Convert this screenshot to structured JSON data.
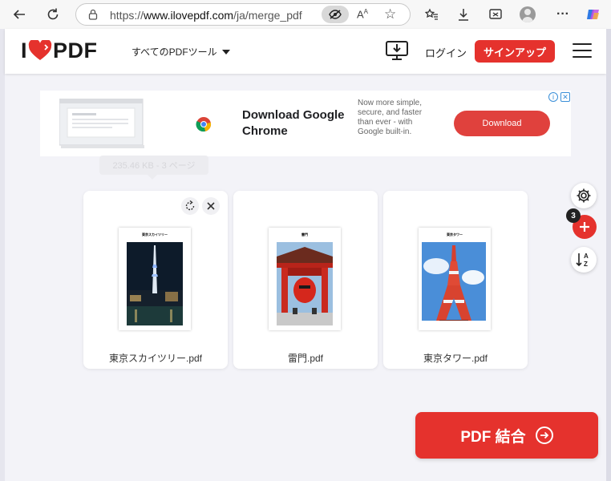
{
  "browser": {
    "url_prefix": "https://",
    "url_host": "www.ilovepdf.com",
    "url_path": "/ja/merge_pdf",
    "reader_label": "A"
  },
  "header": {
    "logo_left": "I",
    "logo_right": "PDF",
    "tools_menu_label": "すべてのPDFツール",
    "login_label": "ログイン",
    "signup_label": "サインアップ"
  },
  "ad": {
    "title": "Download Google Chrome",
    "description": "Now more simple, secure, and faster than ever - with Google built-in.",
    "button_label": "Download"
  },
  "tooltip": {
    "text": "235.46 KB - 3 ページ"
  },
  "files": [
    {
      "name": "東京スカイツリー.pdf",
      "page_title": "東京スカイツリー"
    },
    {
      "name": "雷門.pdf",
      "page_title": "雷門"
    },
    {
      "name": "東京タワー.pdf",
      "page_title": "東京タワー"
    }
  ],
  "sidebar": {
    "file_count": "3"
  },
  "merge_button": {
    "label": "PDF 結合"
  },
  "colors": {
    "brand_red": "#e5322d",
    "background": "#f3f3f8"
  }
}
